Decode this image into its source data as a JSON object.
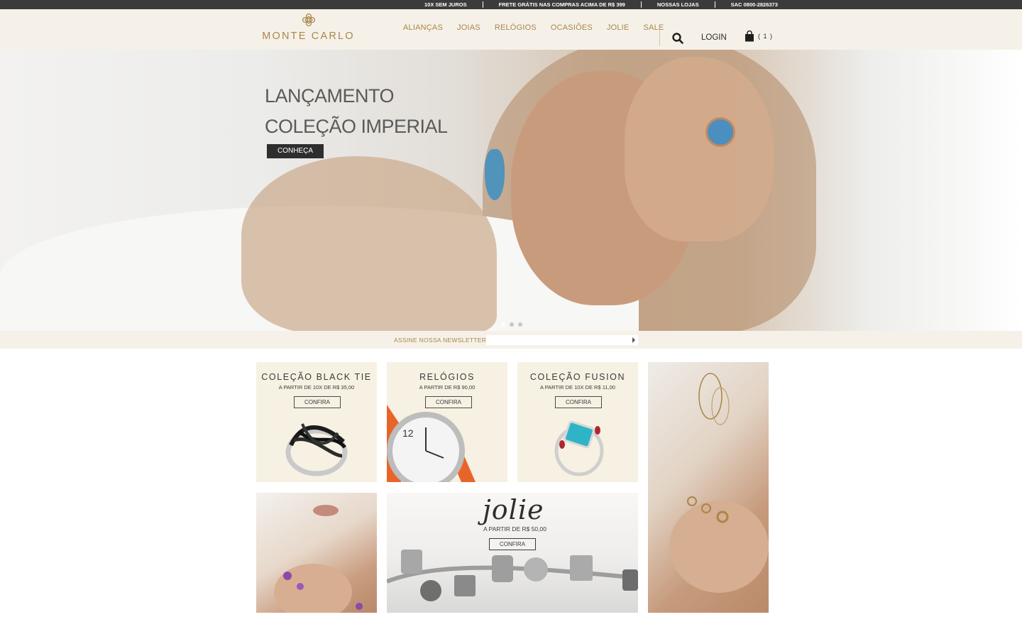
{
  "topbar": {
    "items": [
      "10X SEM JUROS",
      "FRETE GRÁTIS NAS COMPRAS ACIMA DE R$ 399",
      "NOSSAS LOJAS",
      "SAC 0800-2826373"
    ]
  },
  "header": {
    "logo_text": "MONTE CARLO",
    "nav": [
      "ALIANÇAS",
      "JOIAS",
      "RELÓGIOS",
      "OCASIÕES",
      "JOLIE",
      "SALE"
    ],
    "login_label": "LOGIN",
    "cart_count": "( 1 )"
  },
  "hero": {
    "title_line1": "LANÇAMENTO",
    "title_line2": "COLEÇÃO IMPERIAL",
    "button_label": "CONHEÇA",
    "slide_count": 3,
    "active_slide": 1
  },
  "newsletter": {
    "label": "ASSINE NOSSA NEWSLETTER:",
    "placeholder": "",
    "submit_icon": "arrow-right-icon"
  },
  "tiles": [
    {
      "title": "COLEÇÃO BLACK TIE",
      "subtitle": "A PARTIR DE 10X DE R$ 35,00",
      "button": "CONFIRA"
    },
    {
      "title": "RELÓGIOS",
      "subtitle": "A PARTIR DE R$ 90,00",
      "button": "CONFIRA"
    },
    {
      "title": "COLEÇÃO FUSION",
      "subtitle": "A PARTIR DE 10X DE R$ 11,00",
      "button": "CONFIRA"
    }
  ],
  "jolie": {
    "script": "jolie",
    "subtitle": "A PARTIR DE R$ 50,00",
    "button": "CONFIRA"
  },
  "colors": {
    "accent_gold": "#a8864a",
    "topbar_bg": "#3b3b3b",
    "header_bg": "#f6f1e8",
    "tile_bg": "#f6f1e2",
    "button_dark": "#2e2e2e"
  }
}
